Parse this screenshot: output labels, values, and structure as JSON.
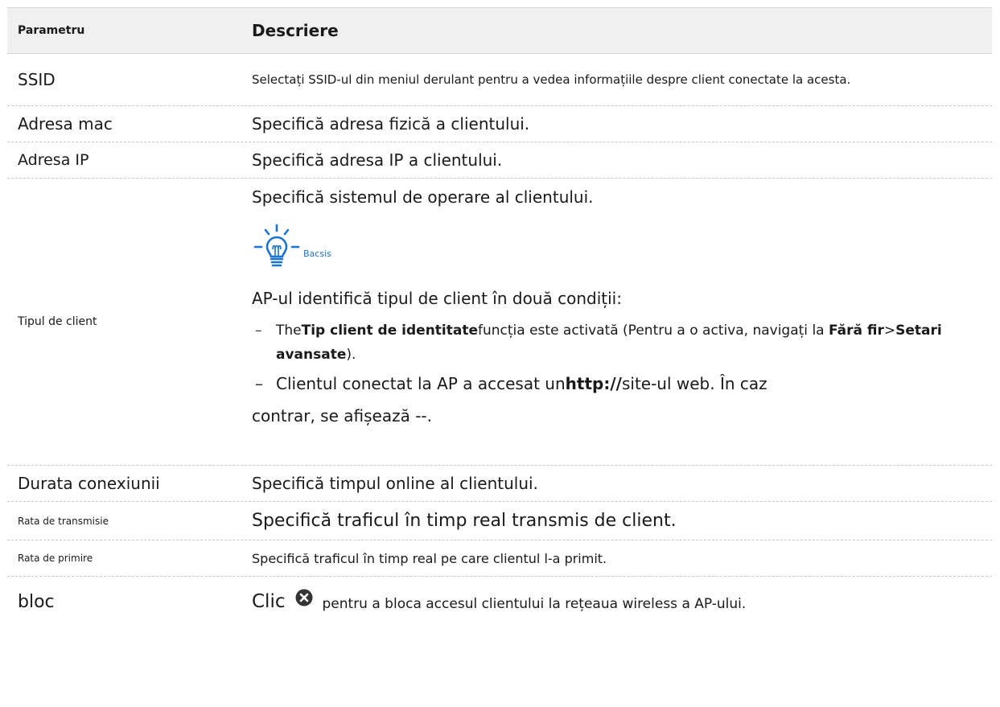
{
  "header": {
    "param": "Parametru",
    "desc": "Descriere"
  },
  "rows": {
    "ssid": {
      "name": "SSID",
      "desc": "Selectați SSID-ul din meniul derulant pentru a vedea informațiile despre client conectate la acesta."
    },
    "mac": {
      "name": "Adresa mac",
      "desc": "Specifică adresa fizică a clientului."
    },
    "ip": {
      "name": "Adresa IP",
      "desc": "Specifică adresa IP a clientului."
    },
    "type": {
      "name": "Tipul de client",
      "desc": "Specifică sistemul de operare al clientului.",
      "tip_label": "Bacsis",
      "conditions_intro": "AP-ul identifică tipul de client în două condiții:",
      "b1_prefix": "The",
      "b1_bold": "Tip client de identitate",
      "b1_mid": "funcția este activată (Pentru a o activa, navigați la ",
      "b1_nav1": "Fără fir",
      "b1_sep": ">",
      "b1_nav2": "Setari avansate",
      "b1_end": ").",
      "b2_prefix": "Clientul conectat la AP a accesat un",
      "b2_bold": "http://",
      "b2_end": "site-ul web. În caz",
      "continuation": "contrar, se afișează --."
    },
    "duration": {
      "name": "Durata conexiunii",
      "desc": "Specifică timpul online al clientului."
    },
    "tx": {
      "name": "Rata de transmisie",
      "desc": "Specifică traficul în timp real transmis de client."
    },
    "rx": {
      "name": "Rata de primire",
      "desc": "Specifică traficul în timp real pe care clientul l-a primit."
    },
    "block": {
      "name": "bloc",
      "clic": "Clic",
      "desc": "pentru a bloca accesul clientului la rețeaua wireless a AP-ului."
    }
  },
  "icons": {
    "tip": "lightbulb-icon",
    "block": "close-circle-icon"
  },
  "colors": {
    "tip_accent": "#1a73d1",
    "header_bg": "#f0f0f0"
  }
}
